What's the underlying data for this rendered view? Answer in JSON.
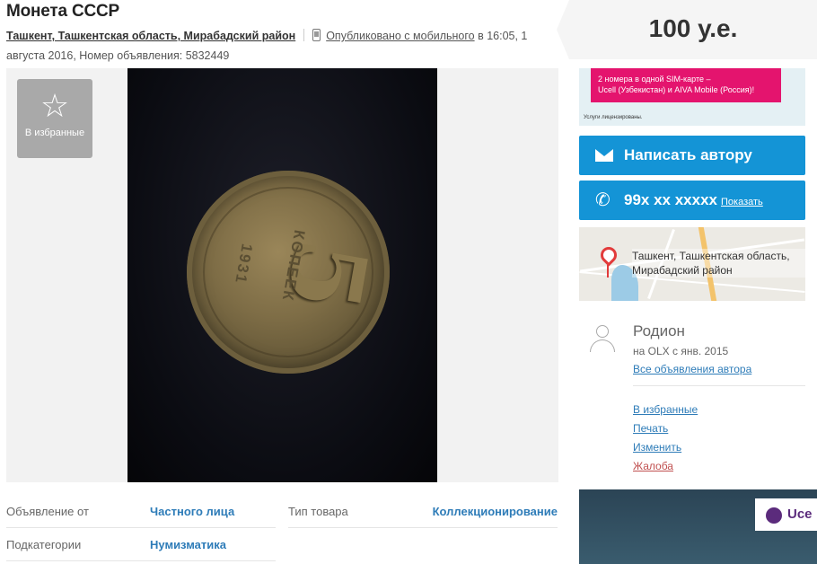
{
  "listing": {
    "title": "Монета СССР",
    "location": "Ташкент, Ташкентская область, Мирабадский район",
    "published_link": "Опубликовано с мобильного",
    "published_rest": " в 16:05, 1 августа 2016, Номер объявления: 5832449"
  },
  "gallery": {
    "favorite_label": "В избранные",
    "coin": {
      "denomination": "5",
      "word": "КОПЕЕК",
      "year": "1931"
    }
  },
  "details": {
    "rows": [
      {
        "key": "Объявление от",
        "value": "Частного лица"
      },
      {
        "key": "Тип товара",
        "value": "Коллекционирование"
      },
      {
        "key": "Подкатегории",
        "value": "Нумизматика"
      }
    ]
  },
  "sidebar": {
    "price": "100 у.е.",
    "banner": {
      "line1": "2 номера в одной SIM-карте –",
      "line2": "Ucell (Узбекистан) и AIVA Mobile (Россия)!",
      "small": "Услуги лицензированы."
    },
    "write_button": "Написать автору",
    "phone_button": "99x xx xxxxx",
    "show_link": "Показать",
    "map_address": "Ташкент, Ташкентская область, Мирабадский район",
    "user": {
      "name": "Родион",
      "since": "на OLX с янв. 2015",
      "all_ads": "Все объявления автора"
    },
    "links": {
      "favorite": "В избранные",
      "print": "Печать",
      "edit": "Изменить",
      "complain": "Жалоба"
    },
    "ad2_brand": "Uce"
  },
  "colors": {
    "accent": "#1494d6",
    "link": "#2e7cb8",
    "complain": "#c05050",
    "banner_pink": "#e4146e"
  },
  "icons": [
    "phone-icon",
    "star-icon",
    "mail-icon",
    "phone-handset-icon",
    "map-pin-icon",
    "user-avatar-icon"
  ]
}
